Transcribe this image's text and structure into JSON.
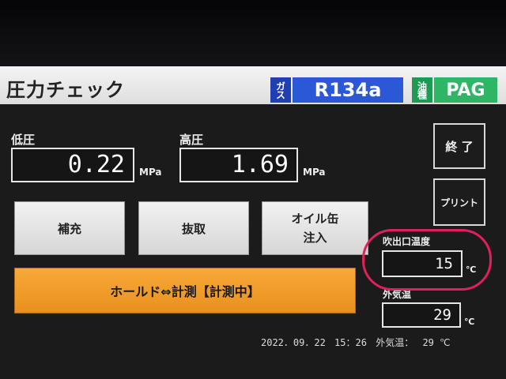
{
  "header": {
    "title": "圧力チェック",
    "gas_label": "ガス",
    "gas_value": "R134a",
    "oil_label": "油種",
    "oil_value": "PAG",
    "gas_color": "#2b58d6",
    "oil_color": "#2fb566"
  },
  "low_pressure": {
    "label": "低圧",
    "value": "0.22",
    "unit": "MPa"
  },
  "high_pressure": {
    "label": "高圧",
    "value": "1.69",
    "unit": "MPa"
  },
  "buttons": {
    "refill": "補充",
    "extract": "抜取",
    "oil_line1": "オイル缶",
    "oil_line2": "注入",
    "hold": "ホールド⇔計測【計測中】",
    "end": "終 了",
    "print": "プリント"
  },
  "outlet_temp": {
    "label": "吹出口温度",
    "value": "15",
    "unit": "℃"
  },
  "outside_temp": {
    "label": "外気温",
    "value": "29",
    "unit": "℃"
  },
  "footer": {
    "date": "2022．09．22",
    "time": "15：26",
    "outside_label": "外気温：",
    "outside_value": "29 ℃"
  },
  "colors": {
    "hold_button": "#f0a02c",
    "highlight_circle": "#e0205a"
  }
}
